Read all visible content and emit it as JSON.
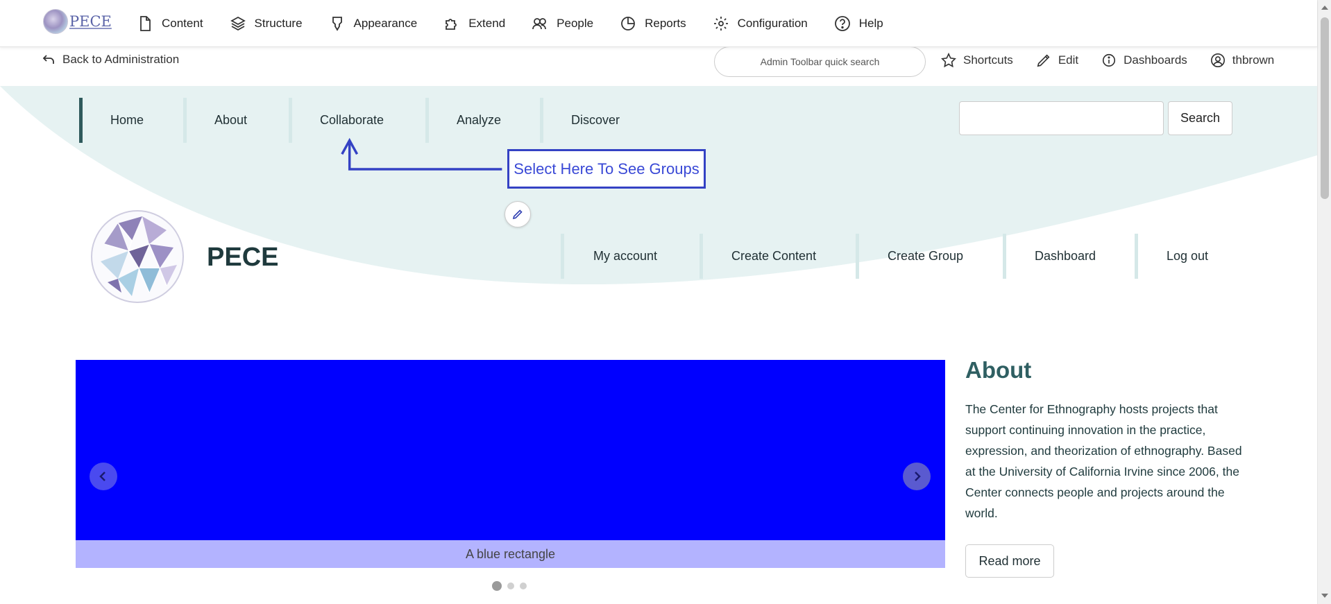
{
  "toolbar": {
    "logo_text": "PECE",
    "items": [
      {
        "label": "Content",
        "icon": "file-icon"
      },
      {
        "label": "Structure",
        "icon": "layers-icon"
      },
      {
        "label": "Appearance",
        "icon": "brush-icon"
      },
      {
        "label": "Extend",
        "icon": "puzzle-icon"
      },
      {
        "label": "People",
        "icon": "people-icon"
      },
      {
        "label": "Reports",
        "icon": "pie-chart-icon"
      },
      {
        "label": "Configuration",
        "icon": "gear-icon"
      },
      {
        "label": "Help",
        "icon": "help-icon"
      }
    ]
  },
  "secondary": {
    "back_label": "Back to Administration",
    "quick_search_placeholder": "Admin Toolbar quick search",
    "items": [
      {
        "label": "Shortcuts",
        "icon": "star-icon"
      },
      {
        "label": "Edit",
        "icon": "pencil-icon"
      },
      {
        "label": "Dashboards",
        "icon": "info-icon"
      },
      {
        "label": "thbrown",
        "icon": "user-icon"
      }
    ]
  },
  "main_nav": {
    "items": [
      "Home",
      "About",
      "Collaborate",
      "Analyze",
      "Discover"
    ],
    "active": "Home"
  },
  "site_search": {
    "button_label": "Search"
  },
  "annotation": {
    "text": "Select Here To See Groups"
  },
  "site": {
    "name": "PECE"
  },
  "user_nav": {
    "items": [
      "My account",
      "Create Content",
      "Create Group",
      "Dashboard",
      "Log out"
    ]
  },
  "carousel": {
    "caption": "A blue rectangle",
    "slide_color": "#0000ff",
    "slide_count": 3,
    "active_slide": 1
  },
  "about": {
    "title": "About",
    "body": "The Center for Ethnography hosts projects that support continuing innovation in the practice, expression, and theorization of  ethnography. Based at the University of California Irvine since 2006, the Center connects people and projects around the world.",
    "read_more_label": "Read more"
  },
  "colors": {
    "accent_teal": "#2f5a5c",
    "hero_bg": "#e6f2f2",
    "annotation_blue": "#3442c4"
  }
}
